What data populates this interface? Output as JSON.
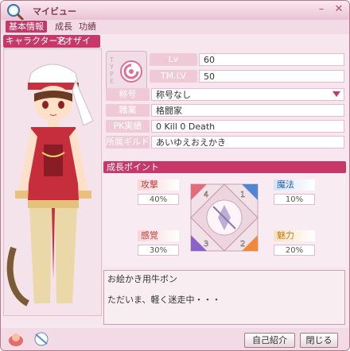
{
  "window": {
    "title": "マイビュー",
    "close_icon": "close-x",
    "minimize_icon": "minus"
  },
  "tabs": [
    {
      "label": "基本情報",
      "active": true
    },
    {
      "label": "成長",
      "active": false
    },
    {
      "label": "功績",
      "active": false
    }
  ],
  "character": {
    "name_label": "キャラクター名",
    "name_value": "アオザイ"
  },
  "type_badge": {
    "letters": [
      "T",
      "Y",
      "P",
      "E"
    ],
    "icon": "cute-swirl-icon"
  },
  "stats": {
    "lv_label": "Lv",
    "lv_value": "60",
    "tmlv_label": "TM.LV",
    "tmlv_value": "50"
  },
  "info": {
    "title_label": "称号",
    "title_value": "称号なし",
    "job_label": "職業",
    "job_value": "格闘家",
    "pk_label": "PK実績",
    "pk_value": "0 Kill  0 Death",
    "guild_label": "所属ギルド",
    "guild_value": "あいゆえおえかき"
  },
  "growth": {
    "header": "成長ポイント",
    "attack_label": "攻撃",
    "attack_value": "40%",
    "magic_label": "魔法",
    "magic_value": "10%",
    "sense_label": "感覚",
    "sense_value": "30%",
    "charm_label": "魅力",
    "charm_value": "20%",
    "corner_numbers": [
      "4",
      "1",
      "3",
      "2"
    ]
  },
  "profile_text": "お絵かき用牛ボン\n\nただいま、軽く迷走中・・・",
  "buttons": {
    "self_intro": "自己紹介",
    "close": "閉じる"
  },
  "colors": {
    "accent": "#c53868",
    "window_bg": "#f7e6ee"
  }
}
